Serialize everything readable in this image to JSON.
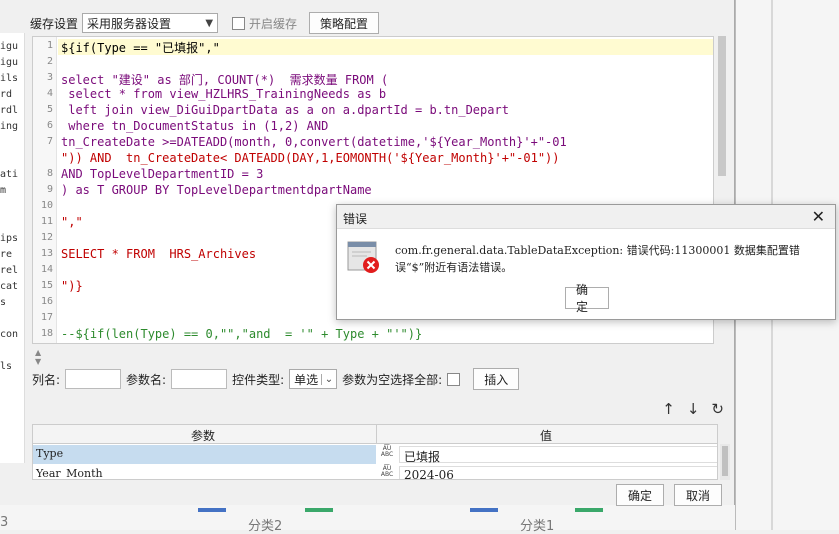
{
  "toolbar": {
    "cache_label": "缓存设置",
    "cache_select": "采用服务器设置",
    "enable_cache_label": "开启缓存",
    "strategy_button": "策略配置"
  },
  "editor": {
    "lines": [
      {
        "n": "1",
        "text": "${if(Type == \"已填报\",\""
      },
      {
        "n": "2",
        "text": ""
      },
      {
        "n": "3",
        "text": "select \"建设\" as 部门, COUNT(*)  需求数量 FROM ("
      },
      {
        "n": "4",
        "text": " select * from view_HZLHRS_TrainingNeeds as b"
      },
      {
        "n": "5",
        "text": " left join view_DiGuiDpartData as a on a.dpartId = b.tn_Depart"
      },
      {
        "n": "6",
        "text": " where tn_DocumentStatus in (1,2) AND"
      },
      {
        "n": "7",
        "text": "tn_CreateDate >=DATEADD(month, 0,convert(datetime,'${Year_Month}'+\"-01"
      },
      {
        "n": "",
        "text": "\")) AND  tn_CreateDate< DATEADD(DAY,1,EOMONTH('${Year_Month}'+\"-01\"))"
      },
      {
        "n": "8",
        "text": "AND TopLevelDepartmentID = 3"
      },
      {
        "n": "9",
        "text": ") as T GROUP BY TopLevelDepartmentdpartName"
      },
      {
        "n": "10",
        "text": ""
      },
      {
        "n": "11",
        "text": "\",\""
      },
      {
        "n": "12",
        "text": ""
      },
      {
        "n": "13",
        "text": "SELECT * FROM  HRS_Archives"
      },
      {
        "n": "14",
        "text": ""
      },
      {
        "n": "15",
        "text": "\")}"
      },
      {
        "n": "16",
        "text": ""
      },
      {
        "n": "17",
        "text": ""
      },
      {
        "n": "18",
        "text": "--${if(len(Type) == 0,\"\",\"and  = '\" + Type + \"'\")}"
      }
    ],
    "colors": {
      "keyword": "#7a0a7a",
      "string": "#c00000",
      "plain": "#000000",
      "comment": "#2e8b2e"
    }
  },
  "fields": {
    "column_label": "列名:",
    "param_label": "参数名:",
    "control_type_label": "控件类型:",
    "control_type_value": "单选",
    "select_all_label": "参数为空选择全部:",
    "insert_button": "插入"
  },
  "params_table": {
    "col_param": "参数",
    "col_value": "值",
    "rows": [
      {
        "name": "Type",
        "value": "已填报",
        "selected": true
      },
      {
        "name": "Year_Month",
        "value": "2024-06",
        "selected": false
      }
    ]
  },
  "footer": {
    "ok": "确定",
    "cancel": "取消"
  },
  "error_dialog": {
    "title": "错误",
    "message": "com.fr.general.data.TableDataException: 错误代码:11300001 数据集配置错误“$”附近有语法错误。",
    "ok": "确定"
  },
  "background": {
    "bottom_labels": [
      "3",
      "分类2",
      "分类1"
    ],
    "left_strip": [
      "igu",
      "igu",
      "ils",
      "rd",
      "rdl",
      "ing",
      "",
      "",
      "ati",
      "m",
      "",
      "",
      "ips",
      "re",
      "rel",
      "cat",
      "s",
      "",
      "con",
      "",
      "ls"
    ]
  }
}
